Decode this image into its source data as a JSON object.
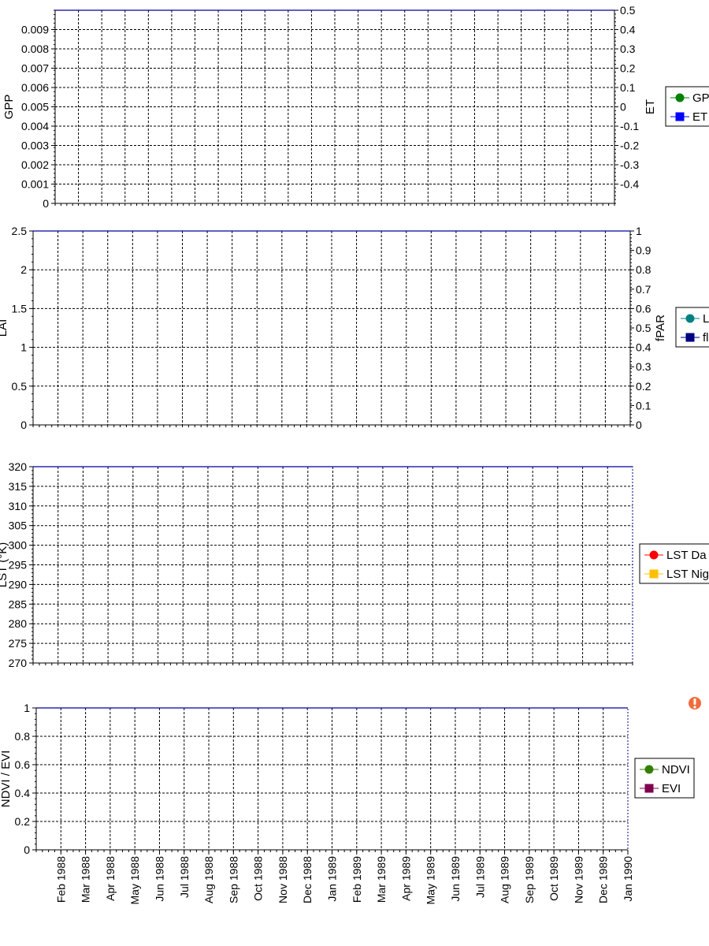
{
  "x_axis": {
    "labels": [
      "Feb 1988",
      "Mar 1988",
      "Apr 1988",
      "May 1988",
      "Jun 1988",
      "Jul 1988",
      "Aug 1988",
      "Sep 1988",
      "Oct 1988",
      "Nov 1988",
      "Dec 1988",
      "Jan 1989",
      "Feb 1989",
      "Mar 1989",
      "Apr 1989",
      "May 1989",
      "Jun 1989",
      "Jul 1989",
      "Aug 1989",
      "Sep 1989",
      "Oct 1989",
      "Nov 1989",
      "Dec 1989",
      "Jan 1990"
    ]
  },
  "warning_icon": "exclamation-icon",
  "chart_data": [
    {
      "type": "line",
      "ylabel": "GPP",
      "y2label": "ET",
      "ylim": [
        0,
        0.01
      ],
      "y2lim": [
        -0.5,
        0.5
      ],
      "yticks": [
        "0",
        "0.001",
        "0.002",
        "0.003",
        "0.004",
        "0.005",
        "0.006",
        "0.007",
        "0.008",
        "0.009"
      ],
      "y2ticks": [
        "-0.4",
        "-0.3",
        "-0.2",
        "-0.1",
        "0",
        "0.1",
        "0.2",
        "0.3",
        "0.4",
        "0.5"
      ],
      "grid": true,
      "legend_position": "right",
      "series": [
        {
          "name": "GP",
          "color": "#008000",
          "marker": "circle",
          "values": []
        },
        {
          "name": "ET",
          "color": "#0000ff",
          "marker": "square",
          "values": []
        }
      ]
    },
    {
      "type": "line",
      "ylabel": "LAI",
      "y2label": "fPAR",
      "ylim": [
        0,
        2.5
      ],
      "y2lim": [
        0,
        1
      ],
      "yticks": [
        "0",
        "0.5",
        "1",
        "1.5",
        "2",
        "2.5"
      ],
      "y2ticks": [
        "0",
        "0.1",
        "0.2",
        "0.3",
        "0.4",
        "0.5",
        "0.6",
        "0.7",
        "0.8",
        "0.9",
        "1"
      ],
      "grid": true,
      "legend_position": "right",
      "series": [
        {
          "name": "L",
          "color": "#008080",
          "marker": "circle",
          "values": []
        },
        {
          "name": "fl",
          "color": "#000080",
          "marker": "square",
          "values": []
        }
      ]
    },
    {
      "type": "line",
      "ylabel": "LST (°K)",
      "ylim": [
        270,
        320
      ],
      "yticks": [
        "270",
        "275",
        "280",
        "285",
        "290",
        "295",
        "300",
        "305",
        "310",
        "315",
        "320"
      ],
      "grid": true,
      "legend_position": "right",
      "series": [
        {
          "name": "LST Da",
          "color": "#ff0000",
          "marker": "circle",
          "values": []
        },
        {
          "name": "LST Nig",
          "color": "#ffc000",
          "marker": "square",
          "values": []
        }
      ]
    },
    {
      "type": "line",
      "ylabel": "NDVI / EVI",
      "ylim": [
        0,
        1
      ],
      "yticks": [
        "0",
        "0.2",
        "0.4",
        "0.6",
        "0.8",
        "1"
      ],
      "grid": true,
      "legend_position": "right",
      "series": [
        {
          "name": "NDVI",
          "color": "#338000",
          "marker": "circle",
          "values": []
        },
        {
          "name": "EVI",
          "color": "#800050",
          "marker": "square",
          "values": []
        }
      ]
    }
  ]
}
